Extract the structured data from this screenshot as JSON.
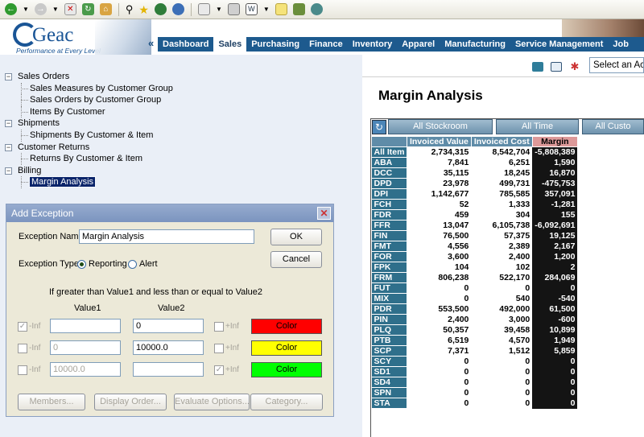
{
  "nav": {
    "items": [
      "Dashboard",
      "Sales",
      "Purchasing",
      "Finance",
      "Inventory",
      "Apparel",
      "Manufacturing",
      "Service Management",
      "Job"
    ],
    "active_index": 1,
    "arrow": "«"
  },
  "logo": {
    "name": "Geac",
    "tagline": "Performance at Every Level",
    "color": "#1a5596"
  },
  "tree": [
    {
      "label": "Sales Orders",
      "toggle": "−",
      "children": [
        "Sales Measures by Customer Group",
        "Sales Orders by Customer Group",
        "Items By Customer"
      ]
    },
    {
      "label": "Shipments",
      "toggle": "−",
      "children": [
        "Shipments By Customer & Item"
      ]
    },
    {
      "label": "Customer Returns",
      "toggle": "−",
      "children": [
        "Returns By Customer & Item"
      ]
    },
    {
      "label": "Billing",
      "toggle": "−",
      "children": [
        "Margin Analysis"
      ]
    }
  ],
  "tree_selected": "Margin Analysis",
  "dialog": {
    "title": "Add Exception",
    "close": "✕",
    "name_label": "Exception Name:",
    "name_value": "Margin Analysis",
    "type_label": "Exception Type:",
    "type_options": [
      "Reporting",
      "Alert"
    ],
    "type_selected": "Reporting",
    "ok": "OK",
    "cancel": "Cancel",
    "rule_text": "If greater than Value1 and less than or equal to Value2",
    "value1_header": "Value1",
    "value2_header": "Value2",
    "neg_inf": "-Inf",
    "pos_inf": "+Inf",
    "rows": [
      {
        "value1": "",
        "value2": "0",
        "color_label": "Color",
        "color": "#ff0000"
      },
      {
        "value1": "0",
        "value2": "10000.0",
        "color_label": "Color",
        "color": "#ffff00"
      },
      {
        "value1": "10000.0",
        "value2": "",
        "color_label": "Color",
        "color": "#00ff00"
      }
    ],
    "footer_buttons": [
      "Members...",
      "Display Order...",
      "Evaluate Options...",
      "Category..."
    ]
  },
  "right": {
    "select_value": "Select an Ac",
    "title": "Margin Analysis",
    "dims": [
      "All Stockroom",
      "All Time",
      "All Custo"
    ],
    "columns": [
      "Invoiced Value",
      "Invoiced Cost",
      "Margin"
    ],
    "rows": [
      [
        "All Item",
        "2,734,315",
        "8,542,704",
        "-5,808,389"
      ],
      [
        "ABA",
        "7,841",
        "6,251",
        "1,590"
      ],
      [
        "DCC",
        "35,115",
        "18,245",
        "16,870"
      ],
      [
        "DPD",
        "23,978",
        "499,731",
        "-475,753"
      ],
      [
        "DPI",
        "1,142,677",
        "785,585",
        "357,091"
      ],
      [
        "FCH",
        "52",
        "1,333",
        "-1,281"
      ],
      [
        "FDR",
        "459",
        "304",
        "155"
      ],
      [
        "FFR",
        "13,047",
        "6,105,738",
        "-6,092,691"
      ],
      [
        "FIN",
        "76,500",
        "57,375",
        "19,125"
      ],
      [
        "FMT",
        "4,556",
        "2,389",
        "2,167"
      ],
      [
        "FOR",
        "3,600",
        "2,400",
        "1,200"
      ],
      [
        "FPK",
        "104",
        "102",
        "2"
      ],
      [
        "FRM",
        "806,238",
        "522,170",
        "284,069"
      ],
      [
        "FUT",
        "0",
        "0",
        "0"
      ],
      [
        "MIX",
        "0",
        "540",
        "-540"
      ],
      [
        "PDR",
        "553,500",
        "492,000",
        "61,500"
      ],
      [
        "PIN",
        "2,400",
        "3,000",
        "-600"
      ],
      [
        "PLQ",
        "50,357",
        "39,458",
        "10,899"
      ],
      [
        "PTB",
        "6,519",
        "4,570",
        "1,949"
      ],
      [
        "SCP",
        "7,371",
        "1,512",
        "5,859"
      ],
      [
        "SCY",
        "0",
        "0",
        "0"
      ],
      [
        "SD1",
        "0",
        "0",
        "0"
      ],
      [
        "SD4",
        "0",
        "0",
        "0"
      ],
      [
        "SPN",
        "0",
        "0",
        "0"
      ],
      [
        "STA",
        "0",
        "0",
        "0"
      ]
    ]
  }
}
